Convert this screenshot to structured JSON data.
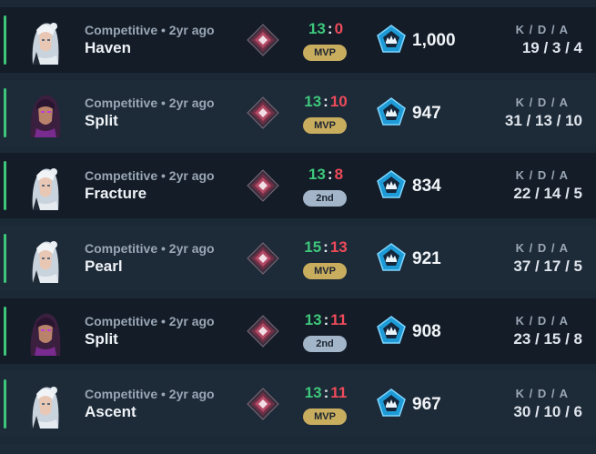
{
  "kda_label": "K / D / A",
  "icons": {
    "rank": "ascendant-rank-icon",
    "rr": "crown-pentagon-icon"
  },
  "colors": {
    "win": "#3ec77b",
    "loss": "#ee4b5a",
    "mvp": "#c9ad5f",
    "second": "#a3b5c9"
  },
  "matches": [
    {
      "agent": "jett",
      "mode": "Competitive • 2yr ago",
      "map": "Haven",
      "score_won": "13",
      "score_sep": ":",
      "score_lost": "0",
      "badge": "MVP",
      "rr": "1,000",
      "kda": "19 / 3 / 4"
    },
    {
      "agent": "reyna",
      "mode": "Competitive • 2yr ago",
      "map": "Split",
      "score_won": "13",
      "score_sep": ":",
      "score_lost": "10",
      "badge": "MVP",
      "rr": "947",
      "kda": "31 / 13 / 10"
    },
    {
      "agent": "jett",
      "mode": "Competitive • 2yr ago",
      "map": "Fracture",
      "score_won": "13",
      "score_sep": ":",
      "score_lost": "8",
      "badge": "2nd",
      "rr": "834",
      "kda": "22 / 14 / 5"
    },
    {
      "agent": "jett",
      "mode": "Competitive • 2yr ago",
      "map": "Pearl",
      "score_won": "15",
      "score_sep": ":",
      "score_lost": "13",
      "badge": "MVP",
      "rr": "921",
      "kda": "37 / 17 / 5"
    },
    {
      "agent": "reyna",
      "mode": "Competitive • 2yr ago",
      "map": "Split",
      "score_won": "13",
      "score_sep": ":",
      "score_lost": "11",
      "badge": "2nd",
      "rr": "908",
      "kda": "23 / 15 / 8"
    },
    {
      "agent": "jett",
      "mode": "Competitive • 2yr ago",
      "map": "Ascent",
      "score_won": "13",
      "score_sep": ":",
      "score_lost": "11",
      "badge": "MVP",
      "rr": "967",
      "kda": "30 / 10 / 6"
    }
  ]
}
